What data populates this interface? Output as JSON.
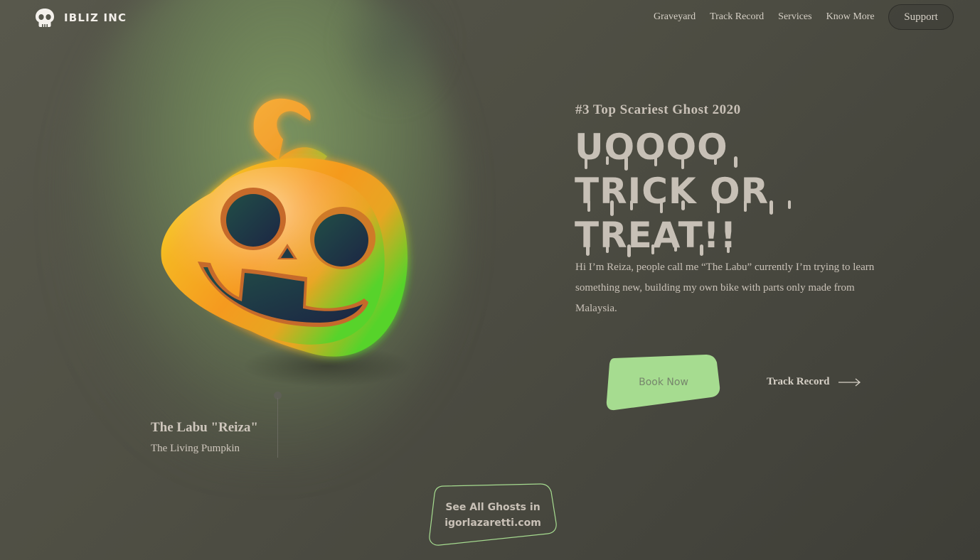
{
  "brand": {
    "name": "IBLIZ INC",
    "logo_icon": "skull-icon"
  },
  "nav": {
    "items": [
      {
        "label": "Graveyard"
      },
      {
        "label": "Track Record"
      },
      {
        "label": "Services"
      },
      {
        "label": "Know More"
      }
    ],
    "support_label": "Support"
  },
  "hero": {
    "eyebrow": "#3 Top Scariest Ghost 2020",
    "headline_lines": [
      "UOOOO",
      "TRICK OR",
      "TREAT!!"
    ],
    "description": "Hi I’m Reiza, people call me “The Labu” currently I’m trying to learn something new, building my own bike with parts only made from Malaysia.",
    "book_label": "Book Now",
    "track_label": "Track Record",
    "track_icon": "arrow-right-icon"
  },
  "character": {
    "name": "The Labu \"Reiza\"",
    "subtitle": "The Living Pumpkin"
  },
  "footer_cta": {
    "line1": "See All Ghosts in",
    "line2": "igorlazaretti.com"
  },
  "colors": {
    "background": "#4f4f44",
    "accent_green": "#a6dc90",
    "text": "#cfc7bd",
    "pumpkin_orange": "#f7931e",
    "pumpkin_green": "#56d12a"
  }
}
